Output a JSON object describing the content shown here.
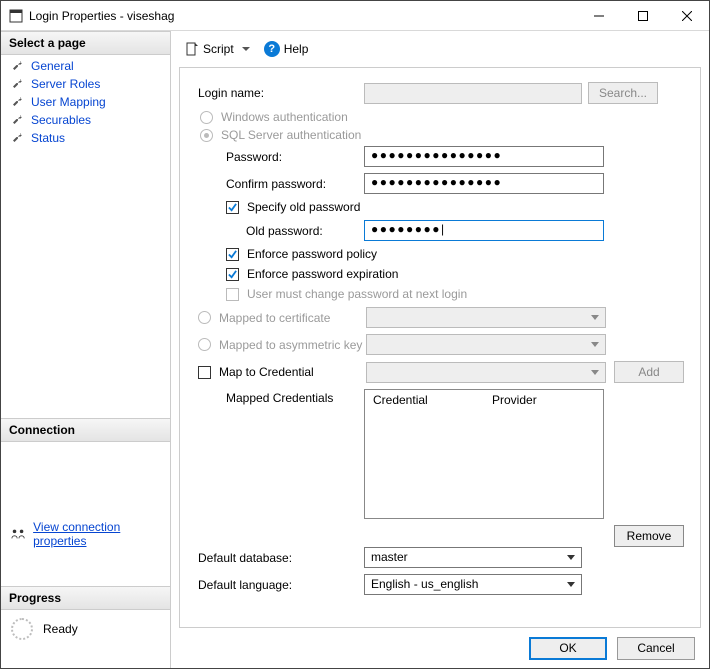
{
  "window": {
    "title": "Login Properties - viseshag"
  },
  "sidebar": {
    "select_page": "Select a page",
    "items": [
      {
        "label": "General"
      },
      {
        "label": "Server Roles"
      },
      {
        "label": "User Mapping"
      },
      {
        "label": "Securables"
      },
      {
        "label": "Status"
      }
    ],
    "connection_header": "Connection",
    "connection_link": "View connection properties",
    "progress_header": "Progress",
    "progress_status": "Ready"
  },
  "toolbar": {
    "script": "Script",
    "help": "Help"
  },
  "form": {
    "login_name_label": "Login name:",
    "login_name_value": "",
    "search": "Search...",
    "windows_auth": "Windows authentication",
    "sql_auth": "SQL Server authentication",
    "password_label": "Password:",
    "password_value": "●●●●●●●●●●●●●●●",
    "confirm_label": "Confirm password:",
    "confirm_value": "●●●●●●●●●●●●●●●",
    "specify_old": "Specify old password",
    "old_password_label": "Old password:",
    "old_password_value": "●●●●●●●●|",
    "enforce_policy": "Enforce password policy",
    "enforce_expiration": "Enforce password expiration",
    "must_change": "User must change password at next login",
    "mapped_cert": "Mapped to certificate",
    "mapped_asym": "Mapped to asymmetric key",
    "map_cred": "Map to Credential",
    "add": "Add",
    "mapped_creds_label": "Mapped Credentials",
    "cred_col": "Credential",
    "prov_col": "Provider",
    "remove": "Remove",
    "default_db_label": "Default database:",
    "default_db_value": "master",
    "default_lang_label": "Default language:",
    "default_lang_value": "English - us_english"
  },
  "footer": {
    "ok": "OK",
    "cancel": "Cancel"
  }
}
